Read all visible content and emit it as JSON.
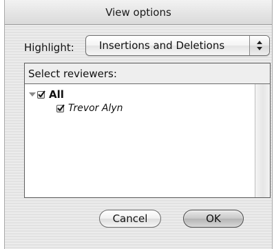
{
  "window": {
    "title": "View options"
  },
  "highlight": {
    "label": "Highlight:",
    "selected": "Insertions and Deletions"
  },
  "reviewers": {
    "header": "Select reviewers:",
    "all_label": "All",
    "all_checked": true,
    "all_expanded": true,
    "items": [
      {
        "label": "Trevor Alyn",
        "checked": true
      }
    ]
  },
  "buttons": {
    "cancel_label": "Cancel",
    "ok_label": "OK"
  },
  "icons": {
    "popup": "up-down-arrows-icon",
    "disclosure": "disclosure-triangle-down-icon",
    "check": "checkmark-icon"
  }
}
